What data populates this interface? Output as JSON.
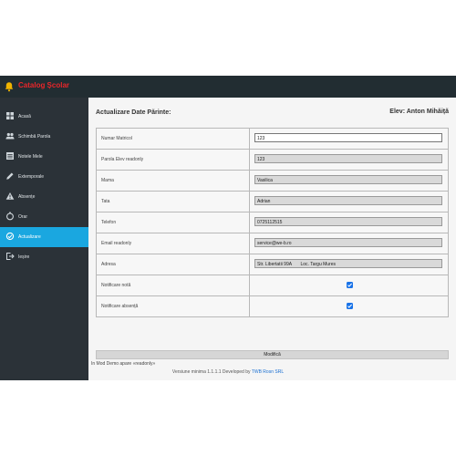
{
  "app": {
    "title": "Catalog Școlar",
    "brand_color": "#e8262a",
    "sidebar_active_color": "#1aa7e0"
  },
  "sidebar": {
    "items": [
      {
        "label": "Acasă",
        "icon": "grid-icon"
      },
      {
        "label": "Schimbă Parola",
        "icon": "users-icon"
      },
      {
        "label": "Notele Mele",
        "icon": "list-icon"
      },
      {
        "label": "Extemporale",
        "icon": "pencil-icon"
      },
      {
        "label": "Absențe",
        "icon": "warning-icon"
      },
      {
        "label": "Orar",
        "icon": "clock-icon"
      },
      {
        "label": "Actualizare",
        "icon": "refresh-icon"
      },
      {
        "label": "Ieșire",
        "icon": "logout-icon"
      }
    ],
    "active_index": 6
  },
  "main": {
    "title": "Actualizare Date Părinte:",
    "student": "Elev: Anton Mihăiță",
    "rows": [
      {
        "label": "Numar Matricol",
        "value": "123"
      },
      {
        "label": "Parola Elev readonly",
        "value": "123"
      },
      {
        "label": "Mama",
        "value": "Vasilica"
      },
      {
        "label": "Tata",
        "value": "Adrian"
      },
      {
        "label": "Telefon",
        "value": "0725112515"
      },
      {
        "label": "Email readonly",
        "value": "service@we-b.ro"
      },
      {
        "label": "Adresa",
        "value_street": "Str. Libertatii 99A",
        "value_city": "Loc. Targu Mures"
      },
      {
        "label": "Notificare notă",
        "checked": true
      },
      {
        "label": "Notificare absență",
        "checked": true
      }
    ],
    "submit_label": "Modifică",
    "demo_note": "In Mod Demo apare «readonly»"
  },
  "footer": {
    "text": "Versiune minima 1.1.1.1 Developed by",
    "link": "TWB Rosn SRL"
  }
}
